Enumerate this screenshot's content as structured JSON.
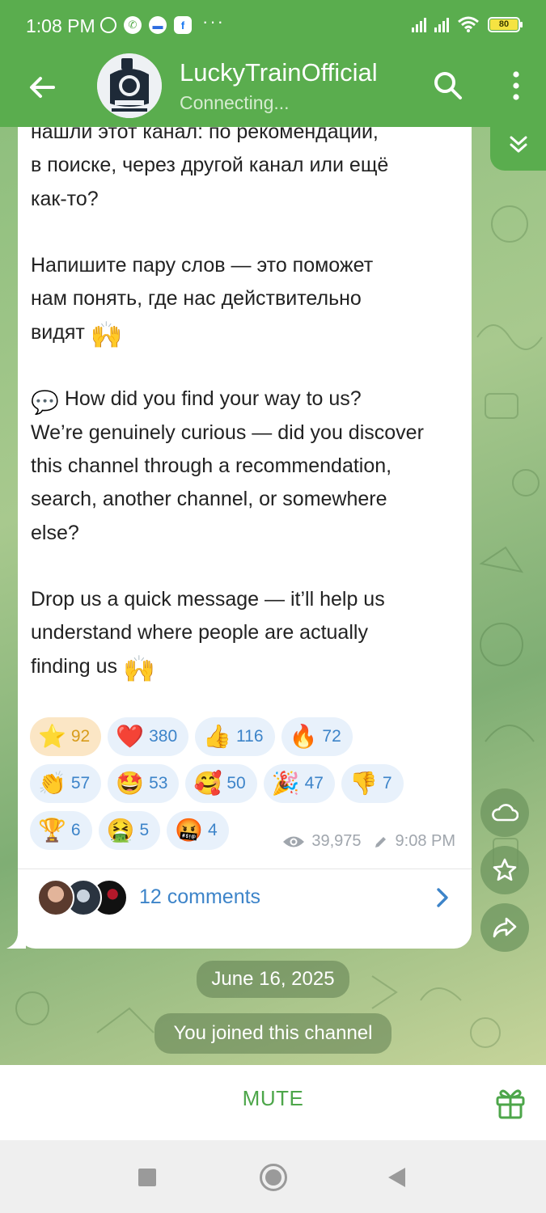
{
  "status_bar": {
    "time": "1:08 PM",
    "battery": "80",
    "notification_icons": [
      "alarm-icon",
      "whatsapp-icon",
      "messages-icon",
      "facebook-icon"
    ],
    "overflow": "···"
  },
  "header": {
    "title": "LuckyTrainOfficial",
    "subtitle": "Connecting...",
    "accent_color": "#5aad4e"
  },
  "message": {
    "lines": [
      "нашли этот канал: по рекомендации,",
      "в поиске, через другой канал или ещё",
      "как-то?",
      "",
      "Напишите пару слов — это поможет",
      "нам понять, где нас действительно",
      "видят",
      "",
      "How did you find your way to us?",
      "We’re genuinely curious — did you discover",
      "this channel through a recommendation,",
      "search, another channel, or somewhere",
      "else?",
      "",
      "Drop us a quick message — it’ll help us",
      "understand where people are actually",
      "finding us"
    ]
  },
  "reactions": [
    [
      {
        "emoji": "⭐",
        "count": "92",
        "active": true
      },
      {
        "emoji": "❤️",
        "count": "380"
      },
      {
        "emoji": "👍",
        "count": "116"
      },
      {
        "emoji": "🔥",
        "count": "72"
      }
    ],
    [
      {
        "emoji": "👏",
        "count": "57"
      },
      {
        "emoji": "🤩",
        "count": "53"
      },
      {
        "emoji": "🥰",
        "count": "50"
      },
      {
        "emoji": "🎉",
        "count": "47"
      },
      {
        "emoji": "👎",
        "count": "7"
      }
    ],
    [
      {
        "emoji": "🏆",
        "count": "6"
      },
      {
        "emoji": "🤮",
        "count": "5"
      },
      {
        "emoji": "🤬",
        "count": "4"
      }
    ]
  ],
  "meta": {
    "views": "39,975",
    "time": "9:08 PM"
  },
  "comments": {
    "label": "12 comments"
  },
  "service": {
    "date": "June 16, 2025",
    "joined": "You joined this channel"
  },
  "bottom": {
    "mute_label": "MUTE"
  }
}
